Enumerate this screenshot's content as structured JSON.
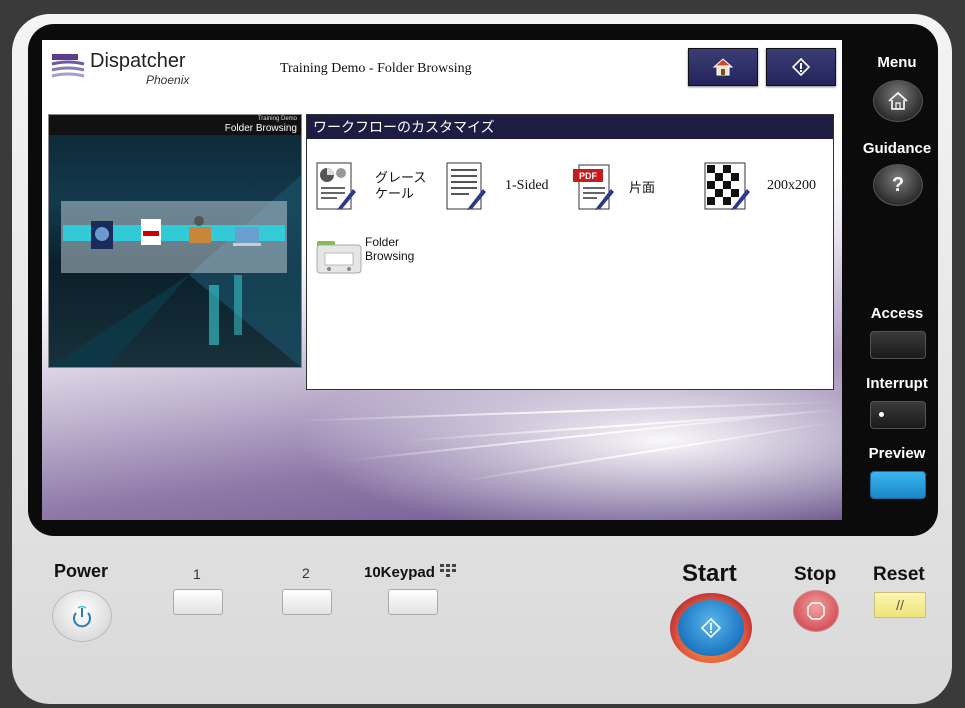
{
  "header": {
    "logo_name": "Dispatcher",
    "logo_sub": "Phoenix",
    "title": "Training Demo - Folder Browsing",
    "home_button_icon": "home-icon",
    "start_button_icon": "start-diamond-icon"
  },
  "preview": {
    "label_small": "Training Demo",
    "label_main": "Folder Browsing"
  },
  "panel": {
    "heading": "ワークフローのカスタマイズ",
    "options": [
      {
        "label_line1": "グレース",
        "label_line2": "ケール",
        "icon": "grayscale-icon"
      },
      {
        "label_line1": "1-Sided",
        "label_line2": "",
        "icon": "one-sided-icon"
      },
      {
        "label_line1": "片面",
        "label_line2": "",
        "icon": "pdf-icon",
        "badge": "PDF"
      },
      {
        "label_line1": "200x200",
        "label_line2": "",
        "icon": "resolution-icon"
      },
      {
        "label_line1": "Folder",
        "label_line2": "Browsing",
        "icon": "folder-icon"
      }
    ]
  },
  "side": {
    "menu": "Menu",
    "guidance": "Guidance",
    "guidance_glyph": "?",
    "access": "Access",
    "interrupt": "Interrupt",
    "preview": "Preview"
  },
  "bottom": {
    "power": "Power",
    "key1": "1",
    "key2": "2",
    "keypad": "10Keypad",
    "start": "Start",
    "stop": "Stop",
    "reset": "Reset",
    "reset_glyph": "//"
  },
  "colors": {
    "header_button": "#2b2c66",
    "panel_head": "#1d1d44",
    "preview_led": "#1ea0e0",
    "reset_button": "#f5ec98"
  }
}
